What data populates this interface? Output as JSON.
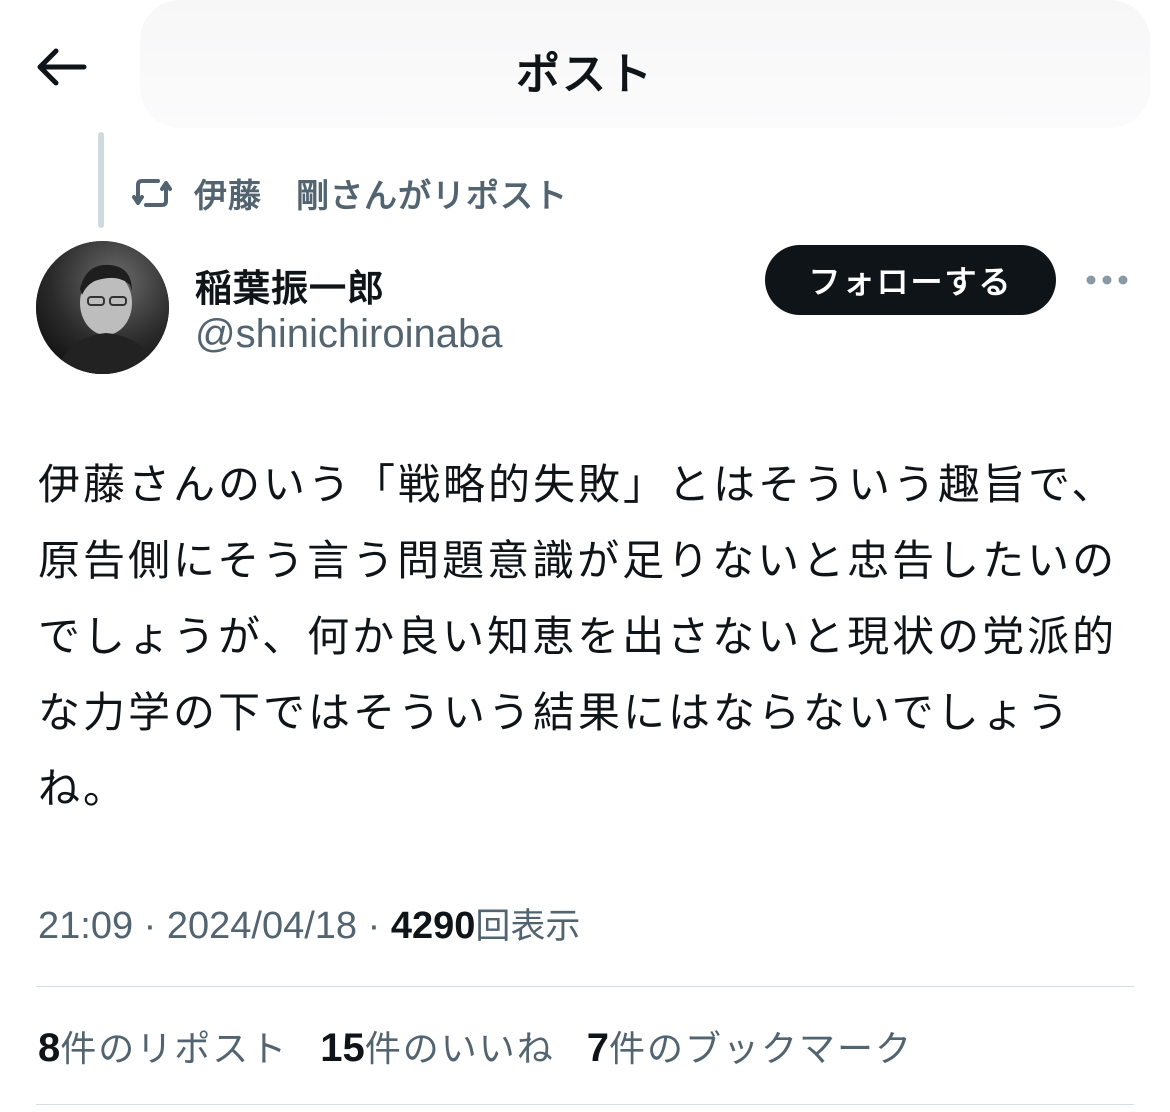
{
  "header": {
    "title": "ポスト",
    "back_icon": "arrow-left-icon"
  },
  "repost": {
    "icon": "repost-icon",
    "text": "伊藤　剛さんがリポスト"
  },
  "author": {
    "display_name": "稲葉振一郎",
    "handle": "@shinichiroinaba",
    "avatar": "avatar-photo"
  },
  "actions": {
    "follow_label": "フォローする",
    "more_icon": "more-horizontal-icon"
  },
  "post": {
    "text": "伊藤さんのいう「戦略的失敗」とはそういう趣旨で、原告側にそう言う問題意識が足りないと忠告したいのでしょうが、何か良い知恵を出さないと現状の党派的な力学の下ではそういう結果にはならないでしょうね。"
  },
  "meta": {
    "time": "21:09",
    "separator": " · ",
    "date": "2024/04/18",
    "views_count": "4290",
    "views_label": "回表示"
  },
  "stats": [
    {
      "count": "8",
      "label": "件のリポスト"
    },
    {
      "count": "15",
      "label": "件のいいね"
    },
    {
      "count": "7",
      "label": "件のブックマーク"
    }
  ],
  "colors": {
    "text_primary": "#0f1419",
    "text_secondary": "#536471",
    "divider": "#d6dde2",
    "follow_bg": "#0f1419"
  }
}
